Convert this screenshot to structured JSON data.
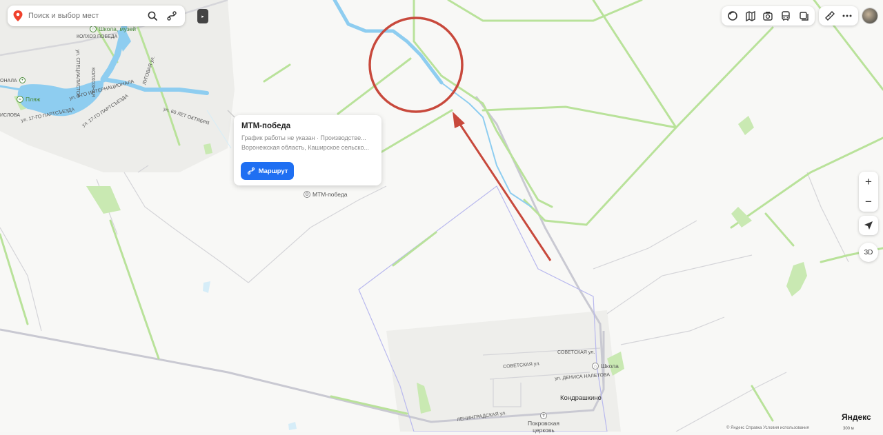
{
  "search": {
    "placeholder": "Поиск и выбор мест"
  },
  "icons": {
    "search": "search-icon",
    "route": "route-icon",
    "collapse": "collapse-arrow-icon",
    "layers": [
      "layers-icon",
      "panorama-icon",
      "photo-icon",
      "transport-icon",
      "stack-icon"
    ],
    "ruler": "ruler-icon",
    "more": "more-icon",
    "locate": "locate-arrow-icon"
  },
  "controls": {
    "zoom_in": "+",
    "zoom_out": "−",
    "three_d": "3D"
  },
  "card": {
    "title": "МТМ-победа",
    "hours": "График работы не указан · Производстве...",
    "address": "Воронежская область, Каширское сельско...",
    "route_label": "Маршрут"
  },
  "map_labels": {
    "kolkhoz": "КОЛХОЗ ПОБЕДА",
    "school_museum": "Школа, музей",
    "beach": "Пляж",
    "poi_mtm": "МТМ-победа",
    "school": "Школа",
    "village": "Кондрашкино",
    "church": "Покровская церковь",
    "streets": {
      "spec": "ул. СПЕЦИАЛИСТОВ",
      "intern": "ул. 3-ГО ИНТЕРНАЦИОНАЛА",
      "lug": "ЛУГОВАЯ ул.",
      "octob": "ул. 60 ЛЕТ ОКТЯБРЯ",
      "partsezd": "ул. 17-ГО ПАРТСЪЕЗДА",
      "kolkhoz2": "КОЛХОЗНАЯ",
      "sovetskaya1": "СОВЕТСКАЯ ул.",
      "sovetskaya2": "СОВЕТСКАЯ ул.",
      "denisa": "ул. ДЕНИСА НАЛЕТОВА",
      "leningrad": "ЛЕНИНГРАДСКАЯ ул.",
      "left1": "ИСЛОВА",
      "left2": "ул. 17-ГО ПАРТСЪЕЗДА",
      "left3": "ОНАЛА"
    }
  },
  "footer": {
    "logo": "Яндекс",
    "copyright": "© Яндекс  Справка  Условия использования",
    "scale": "300 м"
  },
  "colors": {
    "water": "#8ecdf0",
    "field_line": "#b9e29a",
    "road_gray": "#c9c9d2",
    "boundary": "#b8b8ee",
    "annotation": "#c8493c",
    "accent": "#1f6ff2"
  }
}
